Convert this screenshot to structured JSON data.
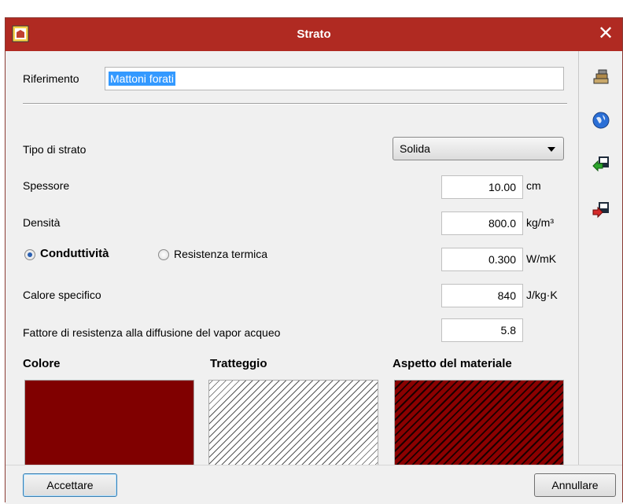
{
  "window": {
    "title": "Strato",
    "close_glyph": "✕",
    "colors": {
      "titlebar": "#b02a22",
      "material": "#800000"
    }
  },
  "riferimento": {
    "label": "Riferimento",
    "value": "Mattoni forati"
  },
  "tipo_strato": {
    "label": "Tipo di strato",
    "selected": "Solida"
  },
  "fields": {
    "spessore": {
      "label": "Spessore",
      "value": "10.00",
      "unit": "cm"
    },
    "densita": {
      "label": "Densità",
      "value": "800.0",
      "unit": "kg/m³"
    },
    "conduttivita": {
      "label": "Conduttività",
      "value": "0.300",
      "unit": "W/mK",
      "checked": true
    },
    "resistenza": {
      "label": "Resistenza termica",
      "checked": false
    },
    "calore": {
      "label": "Calore specifico",
      "value": "840",
      "unit": "J/kg·K"
    },
    "fattore": {
      "label": "Fattore di resistenza alla diffusione del vapor acqueo",
      "value": "5.8"
    }
  },
  "swatches": {
    "colore": "Colore",
    "tratteggio": "Tratteggio",
    "aspetto": "Aspetto del materiale"
  },
  "sidebar_icons": [
    "materials-icon",
    "globe-icon",
    "import-icon",
    "export-icon"
  ],
  "buttons": {
    "accept": "Accettare",
    "cancel": "Annullare"
  }
}
